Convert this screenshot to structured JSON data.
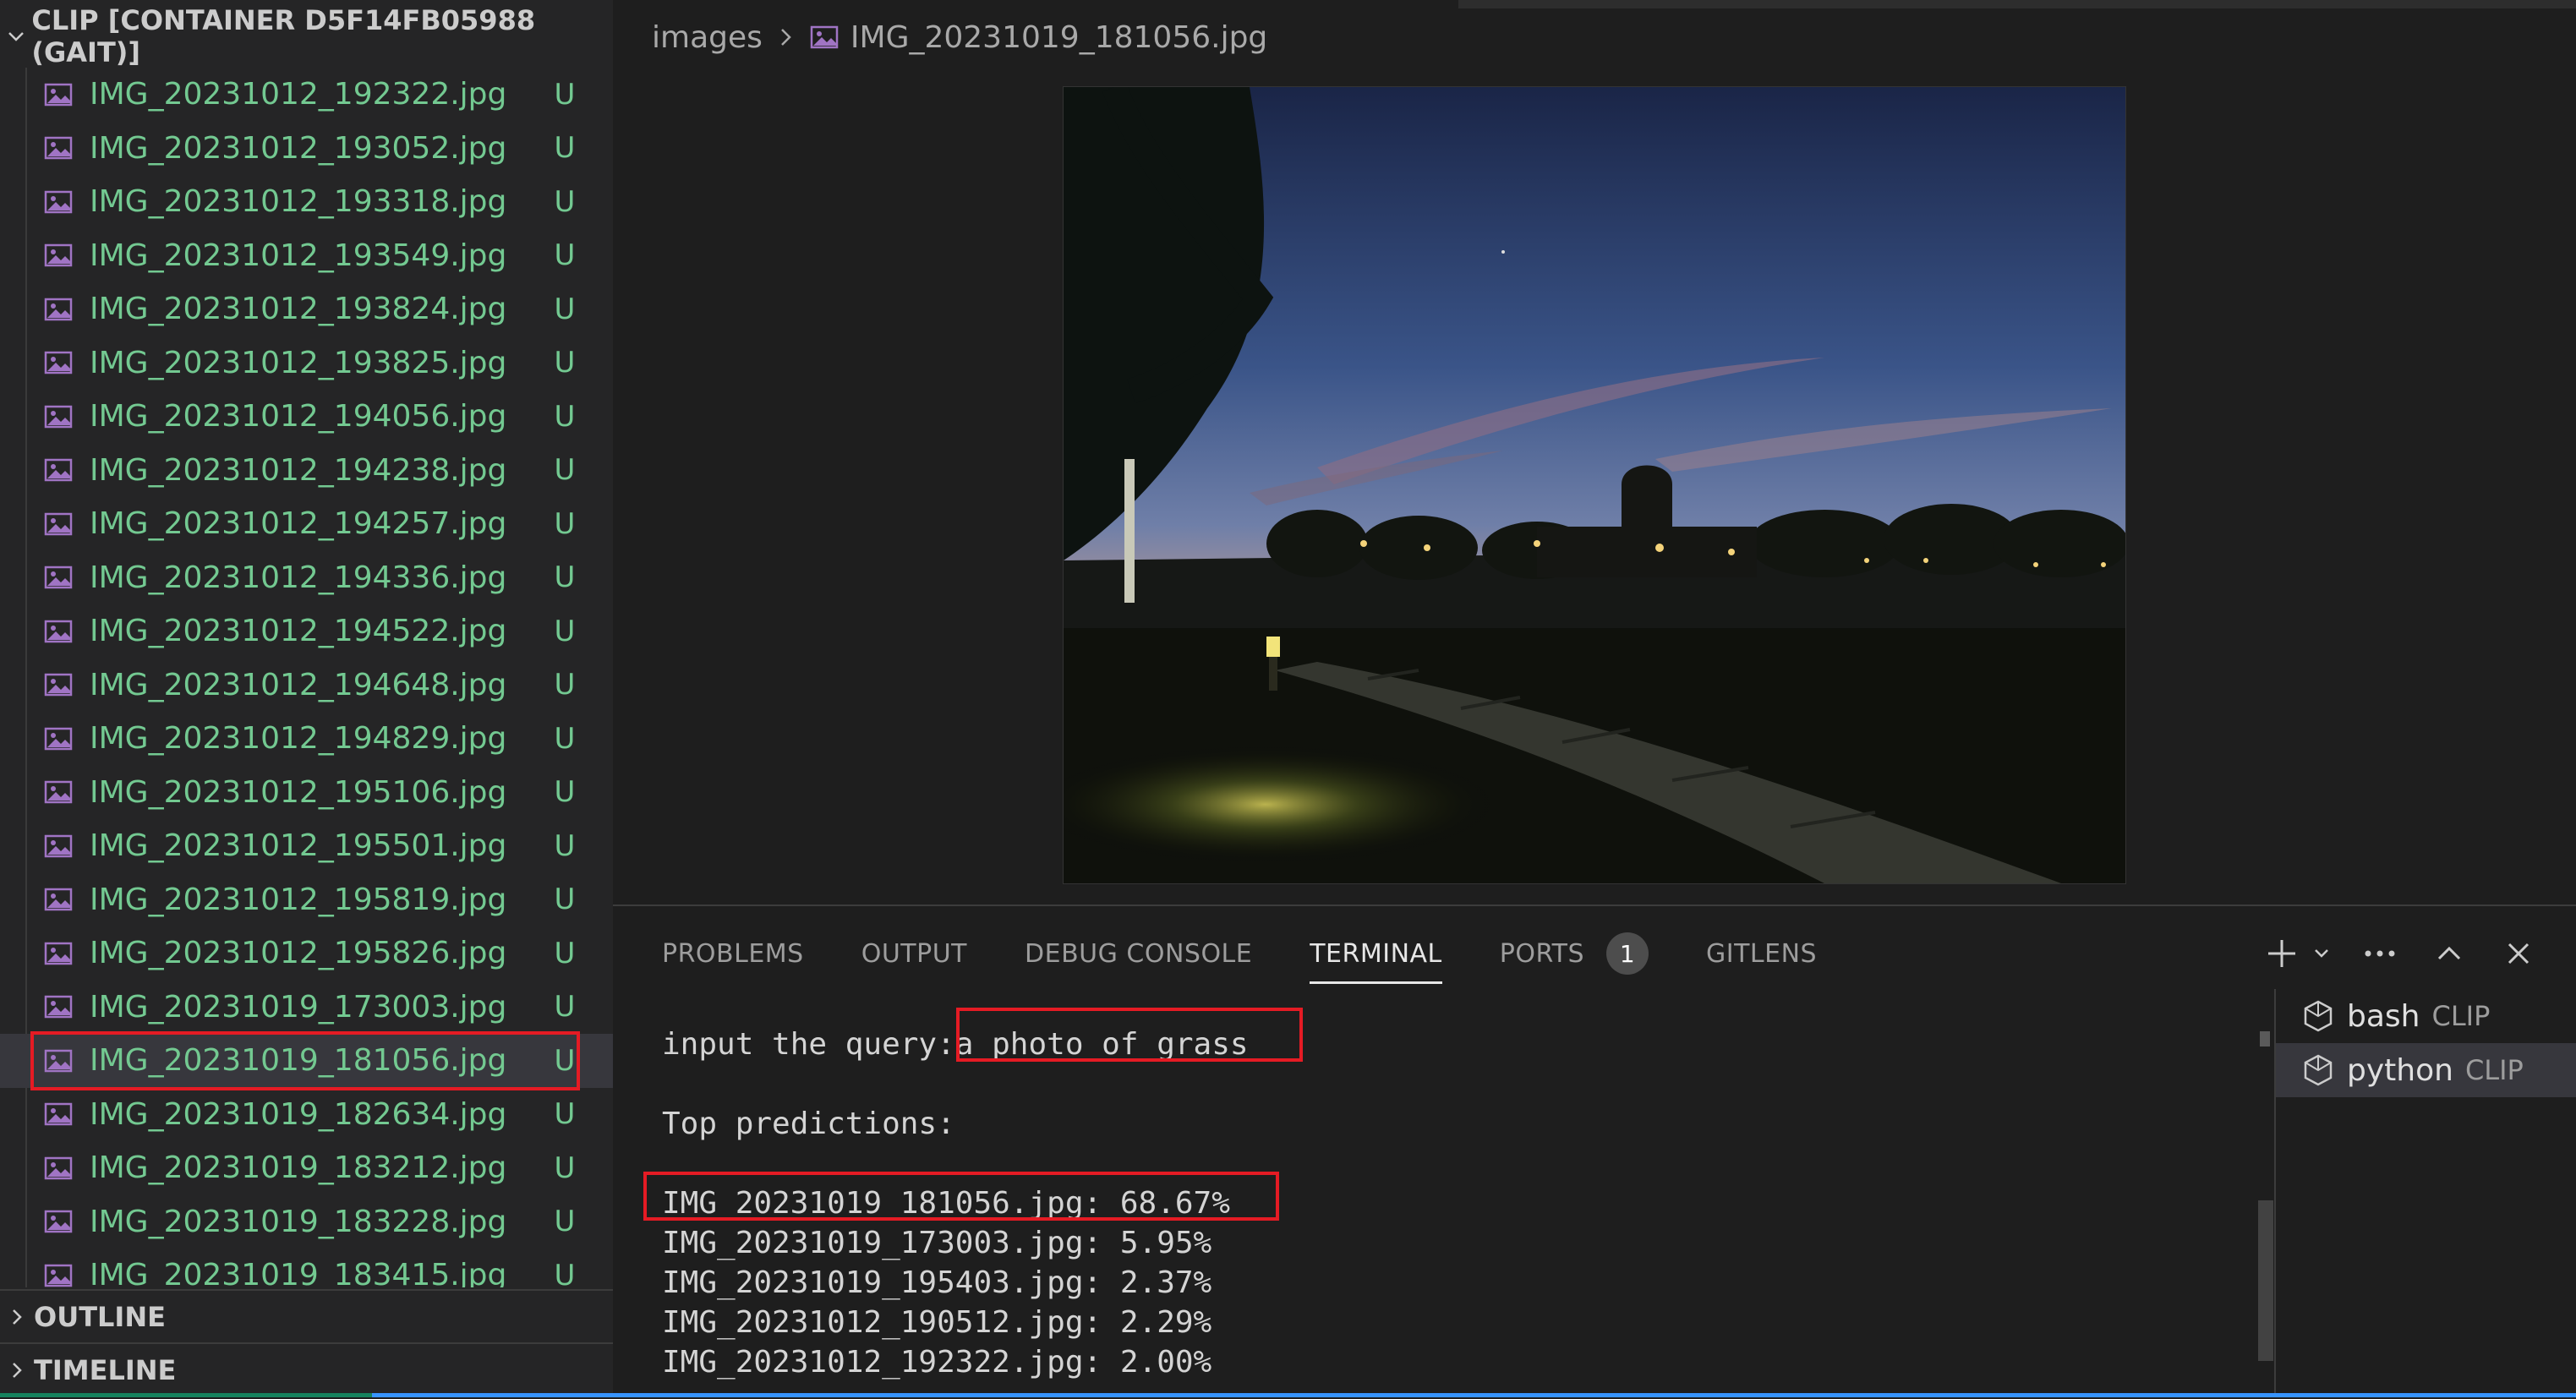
{
  "explorer": {
    "title": "CLIP [CONTAINER D5F14FB05988 (GAIT)]",
    "files": [
      {
        "name": "IMG_20231012_192322.jpg",
        "badge": "U"
      },
      {
        "name": "IMG_20231012_193052.jpg",
        "badge": "U"
      },
      {
        "name": "IMG_20231012_193318.jpg",
        "badge": "U"
      },
      {
        "name": "IMG_20231012_193549.jpg",
        "badge": "U"
      },
      {
        "name": "IMG_20231012_193824.jpg",
        "badge": "U"
      },
      {
        "name": "IMG_20231012_193825.jpg",
        "badge": "U"
      },
      {
        "name": "IMG_20231012_194056.jpg",
        "badge": "U"
      },
      {
        "name": "IMG_20231012_194238.jpg",
        "badge": "U"
      },
      {
        "name": "IMG_20231012_194257.jpg",
        "badge": "U"
      },
      {
        "name": "IMG_20231012_194336.jpg",
        "badge": "U"
      },
      {
        "name": "IMG_20231012_194522.jpg",
        "badge": "U"
      },
      {
        "name": "IMG_20231012_194648.jpg",
        "badge": "U"
      },
      {
        "name": "IMG_20231012_194829.jpg",
        "badge": "U"
      },
      {
        "name": "IMG_20231012_195106.jpg",
        "badge": "U"
      },
      {
        "name": "IMG_20231012_195501.jpg",
        "badge": "U"
      },
      {
        "name": "IMG_20231012_195819.jpg",
        "badge": "U"
      },
      {
        "name": "IMG_20231012_195826.jpg",
        "badge": "U"
      },
      {
        "name": "IMG_20231019_173003.jpg",
        "badge": "U"
      },
      {
        "name": "IMG_20231019_181056.jpg",
        "badge": "U",
        "selected": true
      },
      {
        "name": "IMG_20231019_182634.jpg",
        "badge": "U"
      },
      {
        "name": "IMG_20231019_183212.jpg",
        "badge": "U"
      },
      {
        "name": "IMG_20231019_183228.jpg",
        "badge": "U"
      },
      {
        "name": "IMG_20231019_183415.jpg",
        "badge": "U"
      }
    ],
    "outline_label": "OUTLINE",
    "timeline_label": "TIMELINE"
  },
  "editor": {
    "breadcrumb_folder": "images",
    "breadcrumb_file": "IMG_20231019_181056.jpg"
  },
  "panel": {
    "tabs": {
      "problems": "PROBLEMS",
      "output": "OUTPUT",
      "debug_console": "DEBUG CONSOLE",
      "terminal": "TERMINAL",
      "ports": "PORTS",
      "ports_count": "1",
      "gitlens": "GITLENS"
    },
    "terminal": {
      "query_prompt": "input the query:",
      "query_value": "a photo of grass",
      "predictions_header": "Top predictions:",
      "predictions": [
        "IMG_20231019_181056.jpg: 68.67%",
        "IMG_20231019_173003.jpg: 5.95%",
        "IMG_20231019_195403.jpg: 2.37%",
        "IMG_20231012_190512.jpg: 2.29%",
        "IMG_20231012_192322.jpg: 2.00%"
      ]
    },
    "terminal_list": [
      {
        "name": "bash",
        "sub": "CLIP"
      },
      {
        "name": "python",
        "sub": "CLIP",
        "active": true
      }
    ]
  },
  "colors": {
    "untracked_file": "#73c991",
    "highlight_box": "#e51b24",
    "sidebar_bg": "#252526",
    "editor_bg": "#1e1e1e"
  },
  "icons": {
    "file": "image-file-icon",
    "terminal": "terminal-profile-icon"
  }
}
